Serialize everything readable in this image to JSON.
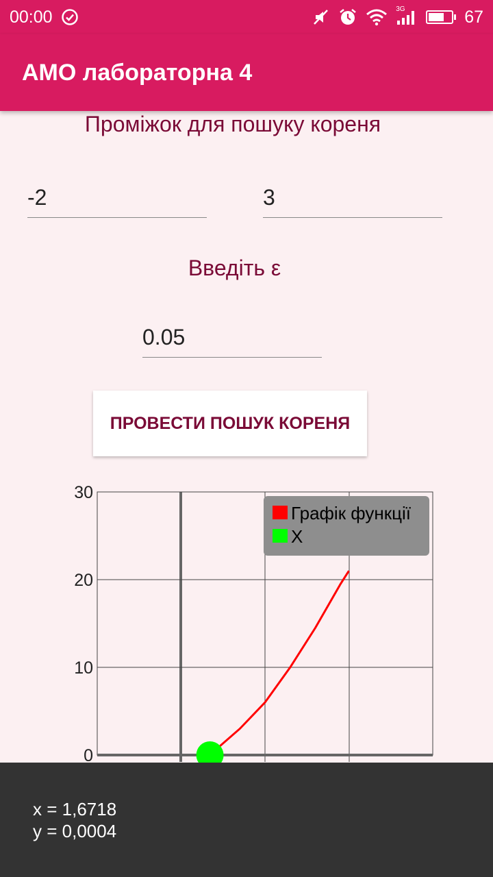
{
  "status_bar": {
    "time": "00:00",
    "battery_pct": "67",
    "network": "3G",
    "icons": [
      "check-circle-icon",
      "mute-icon",
      "alarm-icon",
      "wifi-icon",
      "signal-icon",
      "battery-icon"
    ]
  },
  "app": {
    "title": "АМО лабораторна 4"
  },
  "form": {
    "interval_label": "Проміжок для пошуку кореня",
    "interval_start": "-2",
    "interval_end": "3",
    "epsilon_label": "Введіть ε",
    "epsilon_value": "0.05",
    "search_button": "ПРОВЕСТИ ПОШУК КОРЕНЯ"
  },
  "chart_data": {
    "type": "line",
    "ylim": [
      0,
      30
    ],
    "y_ticks": [
      "30",
      "20",
      "10",
      "0"
    ],
    "legend": [
      {
        "name": "Графік функції",
        "color": "#ff0000"
      },
      {
        "name": "X",
        "color": "#00ff00"
      }
    ],
    "legend_position": "top-right",
    "grid": true,
    "series": [
      {
        "name": "Графік функції",
        "color": "#ff0000",
        "x": [
          1.67,
          1.85,
          2.0,
          2.15,
          2.3,
          2.45,
          2.5
        ],
        "y": [
          0.0,
          3.0,
          6.0,
          10.0,
          14.5,
          19.5,
          21.0
        ]
      }
    ],
    "root_point": {
      "x": 1.6718,
      "y": 0.0004,
      "color": "#00ff00"
    }
  },
  "toast": {
    "x_line": "x = 1,6718",
    "y_line": "y = 0,0004"
  }
}
